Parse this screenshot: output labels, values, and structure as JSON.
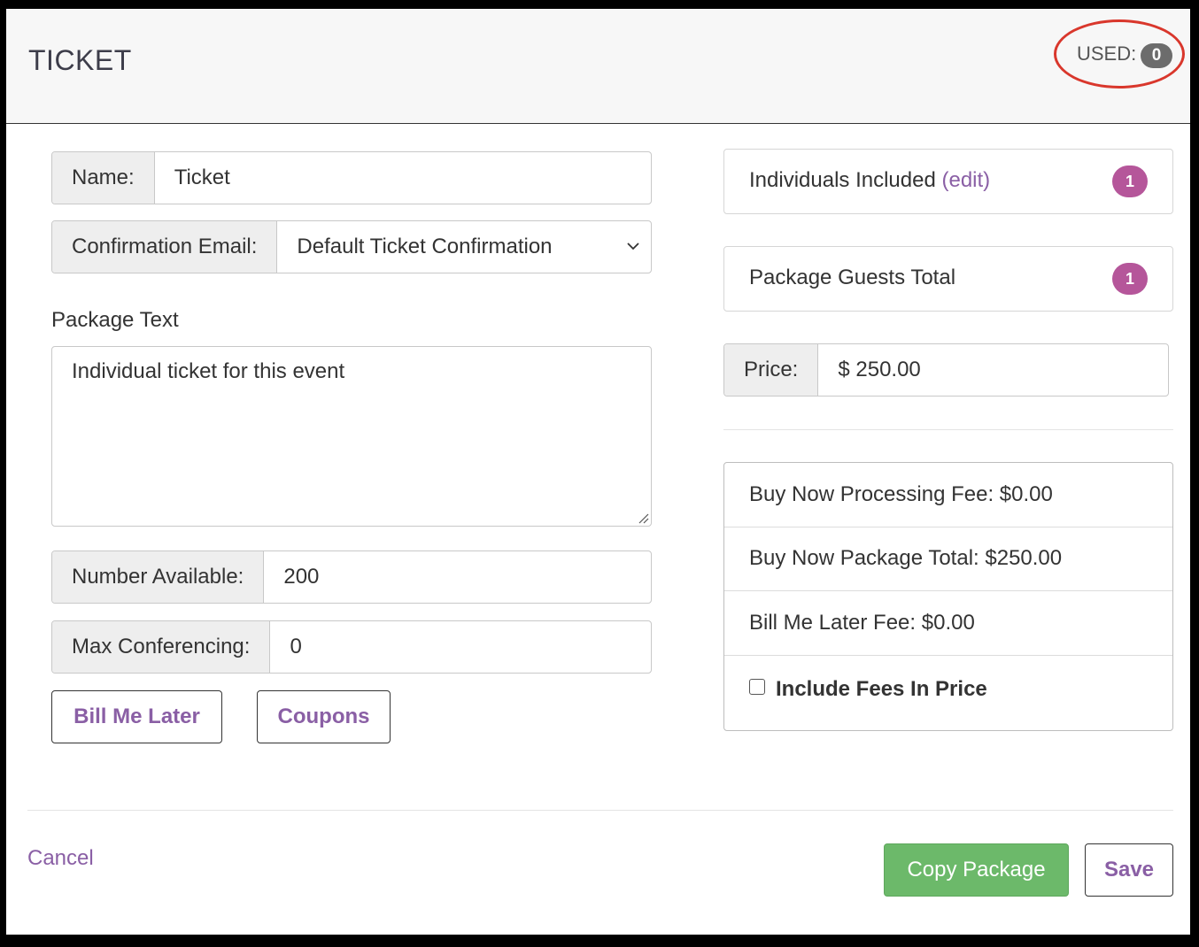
{
  "header": {
    "title": "TICKET",
    "used_label": "USED:",
    "used_count": "0"
  },
  "form": {
    "name": {
      "label": "Name:",
      "value": "Ticket"
    },
    "confirmation_email": {
      "label": "Confirmation Email:",
      "value": "Default Ticket Confirmation"
    },
    "package_text": {
      "label": "Package Text",
      "value": "Individual ticket for this event"
    },
    "number_available": {
      "label": "Number Available:",
      "value": "200"
    },
    "max_conferencing": {
      "label": "Max Conferencing:",
      "value": "0"
    },
    "bill_me_later_label": "Bill Me Later",
    "coupons_label": "Coupons"
  },
  "summary": {
    "individuals_included": {
      "label": "Individuals Included",
      "edit_label": "(edit)",
      "count": "1"
    },
    "package_guests_total": {
      "label": "Package Guests Total",
      "count": "1"
    },
    "price": {
      "label": "Price:",
      "value": "$ 250.00"
    },
    "fees": {
      "processing_fee": "Buy Now Processing Fee: $0.00",
      "package_total": "Buy Now Package Total: $250.00",
      "bill_me_later_fee": "Bill Me Later Fee: $0.00",
      "include_fees_label": "Include Fees In Price",
      "include_fees_checked": false
    }
  },
  "footer": {
    "cancel_label": "Cancel",
    "copy_label": "Copy Package",
    "save_label": "Save"
  },
  "colors": {
    "accent": "#8a5fa5",
    "badge": "#b5569a",
    "success": "#6cb96a",
    "highlight_ring": "#d9372c"
  }
}
